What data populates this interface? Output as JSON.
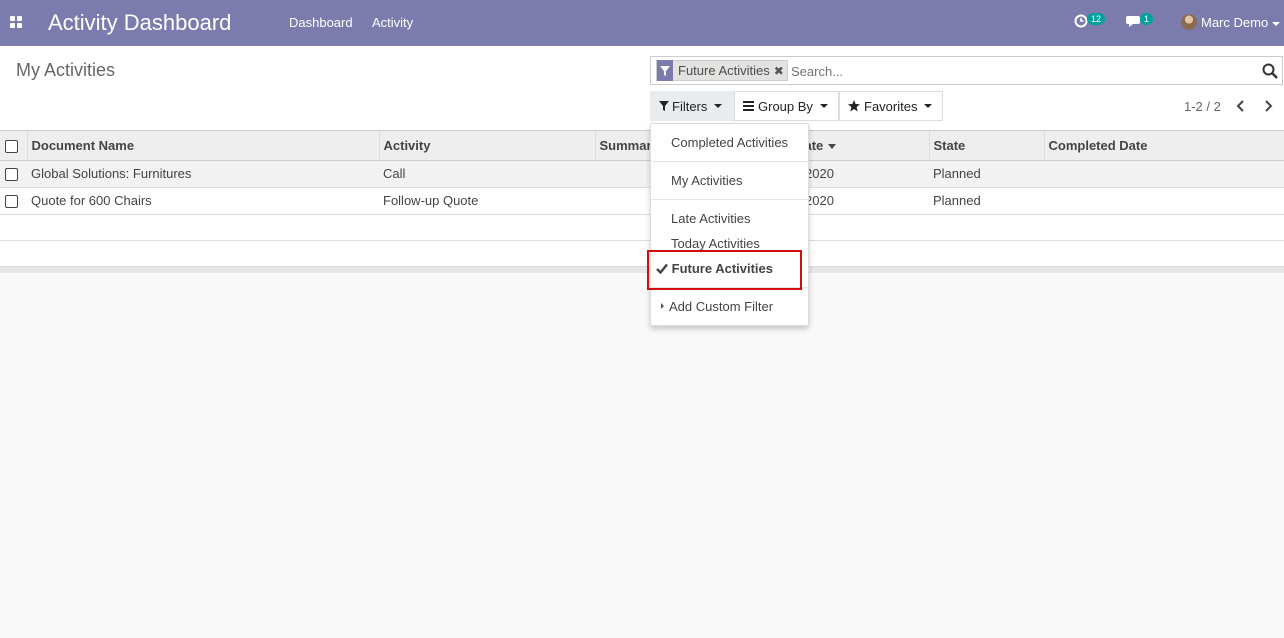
{
  "navbar": {
    "brand": "Activity Dashboard",
    "menu": [
      {
        "label": "Dashboard"
      },
      {
        "label": "Activity"
      }
    ],
    "activities_badge": "12",
    "messages_badge": "1",
    "user_name": "Marc Demo",
    "accent_color": "#7c7bad"
  },
  "control_panel": {
    "breadcrumb": "My Activities",
    "search": {
      "facet_value": "Future Activities",
      "placeholder": "Search..."
    },
    "buttons": {
      "filters": "Filters",
      "group_by": "Group By",
      "favorites": "Favorites"
    },
    "pager": "1-2 / 2"
  },
  "list": {
    "columns": [
      "Document Name",
      "Activity",
      "Summary",
      "Due Date",
      "State",
      "Completed Date"
    ],
    "visible_headers": {
      "document": "Document Name",
      "activity": "Activity",
      "summary": "Summar",
      "due_date": "ate",
      "state": "State",
      "completed": "Completed Date"
    },
    "rows": [
      {
        "document": "Global Solutions: Furnitures",
        "activity": "Call",
        "due_date": "2020",
        "state": "Planned"
      },
      {
        "document": "Quote for 600 Chairs",
        "activity": "Follow-up Quote",
        "due_date": "2020",
        "state": "Planned"
      }
    ]
  },
  "filters_dropdown": {
    "items": {
      "completed": "Completed Activities",
      "my": "My Activities",
      "late": "Late Activities",
      "today": "Today Activities",
      "future": "Future Activities",
      "custom": "Add Custom Filter"
    },
    "selected": "Future Activities",
    "highlight_color": "#d10f0f"
  }
}
